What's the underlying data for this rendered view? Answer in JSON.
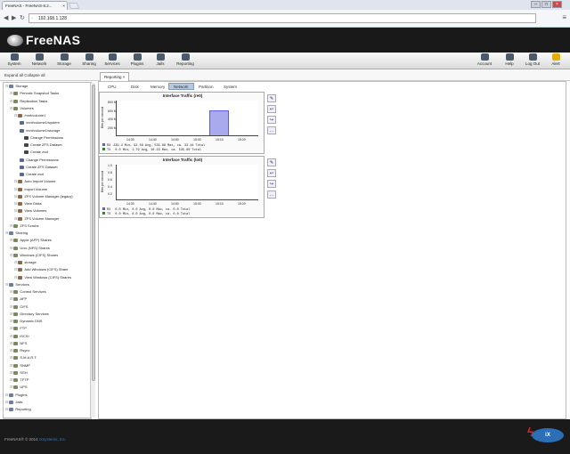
{
  "browser": {
    "tab_title": "FreeNAS - FreeNAS-8.2...",
    "url": "192.168.1.128"
  },
  "app": {
    "logo_text": "FreeNAS",
    "toolbar": [
      {
        "label": "System",
        "icon": "system-icon"
      },
      {
        "label": "Network",
        "icon": "network-icon"
      },
      {
        "label": "Storage",
        "icon": "storage-icon"
      },
      {
        "label": "Sharing",
        "icon": "sharing-icon"
      },
      {
        "label": "Services",
        "icon": "services-icon"
      },
      {
        "label": "Plugins",
        "icon": "plugins-icon"
      },
      {
        "label": "Jails",
        "icon": "jails-icon"
      },
      {
        "label": "Reporting",
        "icon": "reporting-icon"
      }
    ],
    "toolbar_right": [
      {
        "label": "Account",
        "icon": "account-icon"
      },
      {
        "label": "Help",
        "icon": "help-icon"
      },
      {
        "label": "Log Out",
        "icon": "logout-icon"
      },
      {
        "label": "Alert",
        "icon": "alert-icon"
      }
    ],
    "expand_collapse": "Expand all  Collapse all",
    "content_tab": "Reporting"
  },
  "tree": [
    {
      "label": "Storage",
      "level": 1
    },
    {
      "label": "Periodic Snapshot Tasks",
      "level": 2
    },
    {
      "label": "Replication Tasks",
      "level": 2
    },
    {
      "label": "Volumes",
      "level": 2
    },
    {
      "label": "/mnt/volume1",
      "level": 3
    },
    {
      "label": "/mnt/volume1/system",
      "level": 4
    },
    {
      "label": "/mnt/volume1/storage",
      "level": 4
    },
    {
      "label": "Change Permissions",
      "level": 5
    },
    {
      "label": "Create ZFS Dataset",
      "level": 5
    },
    {
      "label": "Create zvol",
      "level": 5
    },
    {
      "label": "Change Permissions",
      "level": 4
    },
    {
      "label": "Create ZFS Dataset",
      "level": 4
    },
    {
      "label": "Create zvol",
      "level": 4
    },
    {
      "label": "Auto Import Volume",
      "level": 3
    },
    {
      "label": "Import Volume",
      "level": 3
    },
    {
      "label": "ZFS Volume Manager (legacy)",
      "level": 3
    },
    {
      "label": "View Disks",
      "level": 3
    },
    {
      "label": "View Volumes",
      "level": 3
    },
    {
      "label": "ZFS Volume Manager",
      "level": 3
    },
    {
      "label": "ZFS Scrubs",
      "level": 2
    },
    {
      "label": "Sharing",
      "level": 1
    },
    {
      "label": "Apple (AFP) Shares",
      "level": 2
    },
    {
      "label": "Unix (NFS) Shares",
      "level": 2
    },
    {
      "label": "Windows (CIFS) Shares",
      "level": 2
    },
    {
      "label": "storage",
      "level": 3
    },
    {
      "label": "Add Windows (CIFS) Share",
      "level": 3
    },
    {
      "label": "View Windows (CIFS) Shares",
      "level": 3
    },
    {
      "label": "Services",
      "level": 1
    },
    {
      "label": "Control Services",
      "level": 2
    },
    {
      "label": "AFP",
      "level": 2
    },
    {
      "label": "CIFS",
      "level": 2
    },
    {
      "label": "Directory Services",
      "level": 2
    },
    {
      "label": "Dynamic DNS",
      "level": 2
    },
    {
      "label": "FTP",
      "level": 2
    },
    {
      "label": "iSCSI",
      "level": 2
    },
    {
      "label": "NFS",
      "level": 2
    },
    {
      "label": "Rsync",
      "level": 2
    },
    {
      "label": "S.M.A.R.T.",
      "level": 2
    },
    {
      "label": "SNMP",
      "level": 2
    },
    {
      "label": "SSH",
      "level": 2
    },
    {
      "label": "TFTP",
      "level": 2
    },
    {
      "label": "UPS",
      "level": 2
    },
    {
      "label": "Plugins",
      "level": 1
    },
    {
      "label": "Jails",
      "level": 1
    },
    {
      "label": "Reporting",
      "level": 1
    }
  ],
  "subtabs": [
    {
      "label": "CPU",
      "active": false
    },
    {
      "label": "Disk",
      "active": false
    },
    {
      "label": "Memory",
      "active": false
    },
    {
      "label": "Network",
      "active": true
    },
    {
      "label": "Partition",
      "active": false
    },
    {
      "label": "System",
      "active": false
    }
  ],
  "graphs": [
    {
      "title": "Interface Traffic (re0)",
      "ylabel": "Bits per second",
      "yticks": [
        "200 M",
        "400 M",
        "600 M",
        "800 M"
      ],
      "xticks": [
        "14:30",
        "14:40",
        "14:50",
        "15:00",
        "15:10",
        "15:20"
      ],
      "legend": [
        {
          "name": "RX",
          "text": "239.4 Min,   92.58 Avg,  535.88 Max,   ca.   33.44 Total",
          "color": "#5d5dd6"
        },
        {
          "name": "TX",
          "text": "  0.0 Min,    1.79 Avg,   10.33 Max,   ca.  535.00 Total",
          "color": "#2d8a2d"
        }
      ]
    },
    {
      "title": "Interface Traffic (lo0)",
      "ylabel": "Bits per second",
      "yticks": [
        "0.2",
        "0.4",
        "0.6",
        "0.8",
        "1.0"
      ],
      "xticks": [
        "14:30",
        "14:40",
        "14:50",
        "15:00",
        "15:10",
        "15:20"
      ],
      "legend": [
        {
          "name": "RX",
          "text": "  0.0 Min,    0.0 Avg,    0.0 Max,   ca.    0.0 Total",
          "color": "#5d5dd6"
        },
        {
          "name": "TX",
          "text": "  0.0 Min,    0.0 Avg,    0.0 Max,   ca.    0.0 Total",
          "color": "#2d8a2d"
        }
      ]
    }
  ],
  "footer": {
    "text": "FreeNAS® © 2014",
    "link": "iXsystems, Inc."
  }
}
